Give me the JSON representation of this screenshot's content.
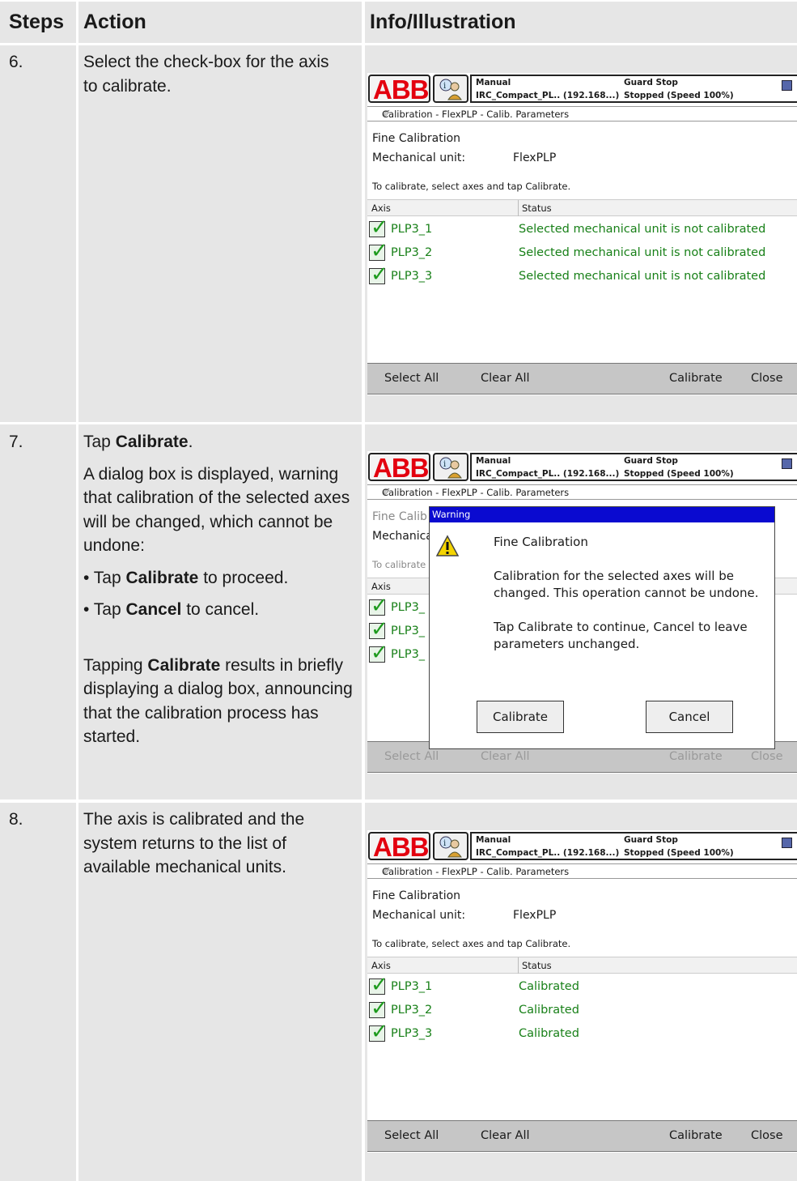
{
  "header": {
    "steps": "Steps",
    "action": "Action",
    "info": "Info/Illustration"
  },
  "rows": [
    {
      "step": "6.",
      "action_lines": [
        "Select the check-box for the axis",
        "to calibrate."
      ]
    },
    {
      "step": "7.",
      "tap_prefix": "Tap ",
      "tap_bold": "Calibrate",
      "tap_suffix": ".",
      "para1": "A dialog box is displayed, warning that calibration of the selected axes will be changed, which cannot be undone:",
      "bullet1_prefix": "• Tap ",
      "bullet1_bold": "Calibrate",
      "bullet1_suffix": " to proceed.",
      "bullet2_prefix": "• Tap ",
      "bullet2_bold": "Cancel",
      "bullet2_suffix": " to cancel.",
      "para2_prefix": "Tapping ",
      "para2_bold": "Calibrate",
      "para2_suffix": " results in briefly displaying a dialog box, announcing that the calibration process has started."
    },
    {
      "step": "8.",
      "action": "The axis is calibrated and the system returns to the list of available mechanical units."
    }
  ],
  "screen": {
    "logo": "ABB",
    "mode": "Manual",
    "controller": "IRC_Compact_PL.. (192.168...)",
    "guard": "Guard Stop",
    "state": "Stopped (Speed 100%)",
    "title": "Calibration - FlexPLP - Calib. Parameters",
    "fine_cal": "Fine Calibration",
    "mech_label": "Mechanical unit:",
    "mech_value": "FlexPLP",
    "instruction": "To calibrate, select axes and tap Calibrate.",
    "col_axis": "Axis",
    "col_status": "Status",
    "axes": [
      "PLP3_1",
      "PLP3_2",
      "PLP3_3"
    ],
    "status_not": "Selected mechanical unit is not calibrated",
    "status_ok": "Calibrated",
    "btn_select_all": "Select All",
    "btn_clear_all": "Clear All",
    "btn_calibrate": "Calibrate",
    "btn_close": "Close",
    "trunc_fine": "Fine Calib",
    "trunc_mech": "Mechanica",
    "trunc_instr": "To calibrate",
    "trunc_axis": "PLP3_"
  },
  "dialog": {
    "title": "Warning",
    "heading": "Fine Calibration",
    "msg1_line1": "Calibration for the selected axes will be",
    "msg1_line2": "changed. This operation cannot be undone.",
    "msg2_line1": "Tap Calibrate to continue, Cancel to leave",
    "msg2_line2": "parameters unchanged.",
    "btn_calibrate": "Calibrate",
    "btn_cancel": "Cancel",
    "icon": "warning-triangle-icon"
  }
}
